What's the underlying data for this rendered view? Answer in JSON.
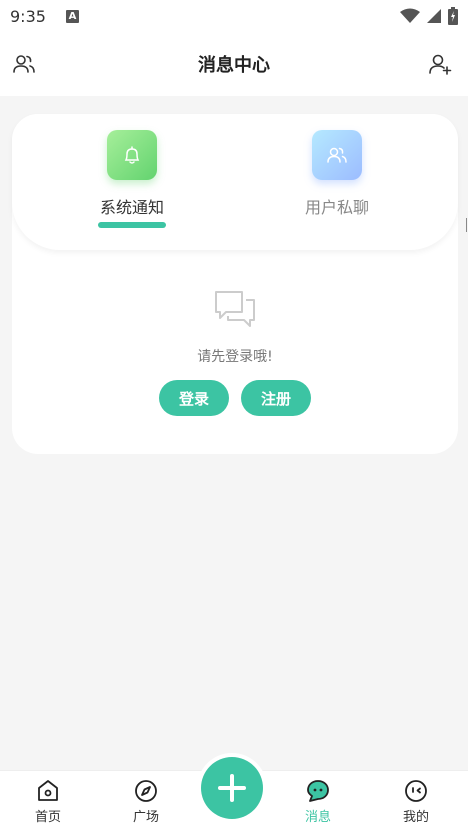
{
  "status_bar": {
    "time": "9:35",
    "notification_letter": "A"
  },
  "header": {
    "title": "消息中心"
  },
  "tabs": [
    {
      "label": "系统通知",
      "active": true,
      "icon": "bell-icon"
    },
    {
      "label": "用户私聊",
      "active": false,
      "icon": "users-icon"
    }
  ],
  "empty_state": {
    "icon": "chat-bubbles-icon",
    "message": "请先登录哦!"
  },
  "buttons": {
    "login": "登录",
    "register": "注册"
  },
  "bottom_nav": [
    {
      "label": "首页",
      "icon": "home-icon",
      "active": false
    },
    {
      "label": "广场",
      "icon": "compass-icon",
      "active": false
    },
    {
      "label": "消息",
      "icon": "message-icon",
      "active": true
    },
    {
      "label": "我的",
      "icon": "face-icon",
      "active": false
    }
  ],
  "colors": {
    "accent": "#3cc4a3",
    "background": "#f5f5f5"
  }
}
